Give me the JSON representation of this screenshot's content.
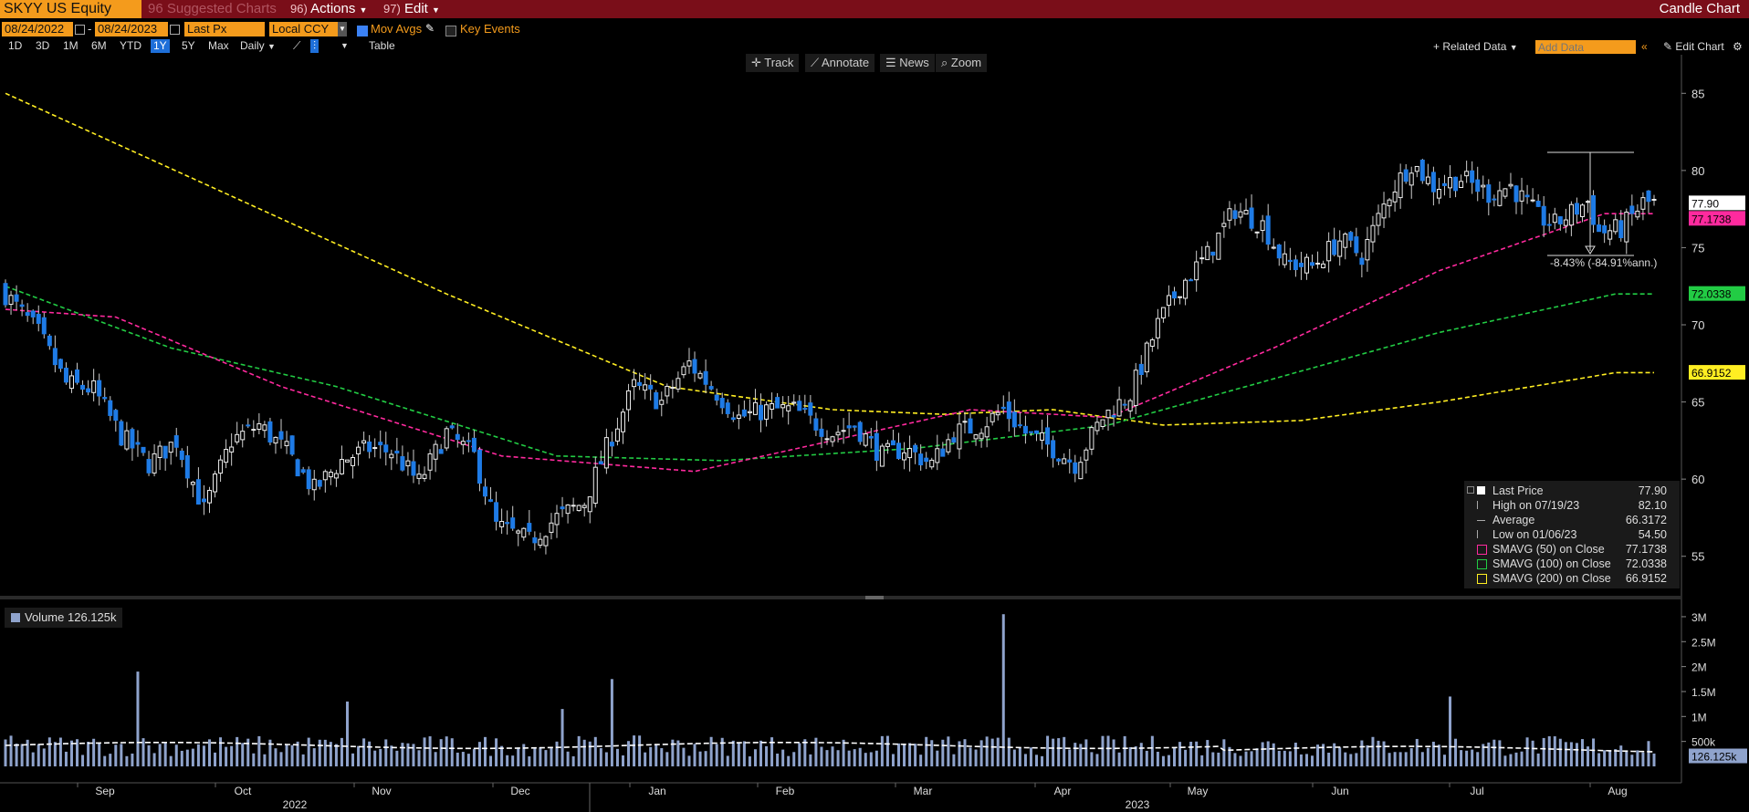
{
  "header": {
    "ticker": "SKYY US Equity",
    "suggested_charts": "Suggested Charts",
    "suggested_num": "96",
    "actions_num": "96)",
    "actions": "Actions",
    "edit_num": "97)",
    "edit": "Edit",
    "chart_type": "Candle Chart"
  },
  "controls": {
    "start_date": "08/24/2022",
    "end_date": "08/24/2023",
    "field": "Last Px",
    "currency": "Local CCY",
    "mov_avgs": "Mov Avgs",
    "key_events": "Key Events",
    "periods": [
      "1D",
      "3D",
      "1M",
      "6M",
      "YTD",
      "1Y",
      "5Y",
      "Max"
    ],
    "selected_period": "1Y",
    "frequency": "Daily",
    "table": "Table",
    "related_data": "+ Related Data",
    "add_data_placeholder": "Add Data",
    "edit_chart": "Edit Chart"
  },
  "tools": [
    "Track",
    "Annotate",
    "News",
    "Zoom"
  ],
  "legend": {
    "items": [
      {
        "name": "Last Price",
        "value": "77.90",
        "color": "#ffffff"
      },
      {
        "name": "High on 07/19/23",
        "value": "82.10",
        "color": "#bbbbbb"
      },
      {
        "name": "Average",
        "value": "66.3172",
        "color": "#bbbbbb"
      },
      {
        "name": "Low on 01/06/23",
        "value": "54.50",
        "color": "#bbbbbb"
      },
      {
        "name": "SMAVG (50)  on Close",
        "value": "77.1738",
        "color": "#ff2a9e"
      },
      {
        "name": "SMAVG (100)  on Close",
        "value": "72.0338",
        "color": "#22cc44"
      },
      {
        "name": "SMAVG (200)  on Close",
        "value": "66.9152",
        "color": "#ffee22"
      }
    ]
  },
  "chart_data": {
    "type": "candlestick",
    "price_axis": {
      "ticks": [
        55,
        60,
        65,
        70,
        75,
        80,
        85
      ],
      "range": [
        52.5,
        87.5
      ]
    },
    "x_axis": {
      "months": [
        "Sep",
        "Oct",
        "Nov",
        "Dec",
        "Jan",
        "Feb",
        "Mar",
        "Apr",
        "May",
        "Jun",
        "Jul",
        "Aug"
      ],
      "years": [
        "2022",
        "2023"
      ]
    },
    "price_series": [
      [
        0,
        72.0
      ],
      [
        6,
        69.5
      ],
      [
        11,
        66.2
      ],
      [
        16,
        65.8
      ],
      [
        21,
        62.8
      ],
      [
        26,
        61.0
      ],
      [
        31,
        62.5
      ],
      [
        36,
        58.0
      ],
      [
        41,
        62.5
      ],
      [
        46,
        63.5
      ],
      [
        51,
        61.8
      ],
      [
        56,
        59.3
      ],
      [
        61,
        61.2
      ],
      [
        66,
        62.0
      ],
      [
        70,
        61.8
      ],
      [
        75,
        59.8
      ],
      [
        80,
        63.0
      ],
      [
        85,
        61.5
      ],
      [
        89,
        57.0
      ],
      [
        95,
        56.0
      ],
      [
        100,
        57.5
      ],
      [
        105,
        58.5
      ],
      [
        109,
        62.0
      ],
      [
        114,
        66.0
      ],
      [
        119,
        65.0
      ],
      [
        124,
        67.5
      ],
      [
        128,
        66.0
      ],
      [
        133,
        64.0
      ],
      [
        138,
        64.5
      ],
      [
        143,
        64.5
      ],
      [
        146,
        63.8
      ],
      [
        150,
        63.0
      ],
      [
        154,
        63.5
      ],
      [
        159,
        61.5
      ],
      [
        163,
        62.0
      ],
      [
        168,
        61.0
      ],
      [
        172,
        63.0
      ],
      [
        177,
        63.5
      ],
      [
        181,
        64.5
      ],
      [
        185,
        63.0
      ],
      [
        190,
        62.0
      ],
      [
        194,
        61.0
      ],
      [
        199,
        64.0
      ],
      [
        204,
        65.5
      ],
      [
        209,
        70.0
      ],
      [
        213,
        72.5
      ],
      [
        218,
        74.5
      ],
      [
        223,
        77.5
      ],
      [
        228,
        76.5
      ],
      [
        232,
        74.0
      ],
      [
        237,
        73.8
      ],
      [
        242,
        75.5
      ],
      [
        246,
        74.5
      ],
      [
        251,
        78.5
      ],
      [
        255,
        80.5
      ],
      [
        259,
        79.0
      ],
      [
        264,
        79.5
      ],
      [
        269,
        78.5
      ],
      [
        273,
        79.0
      ],
      [
        278,
        77.0
      ],
      [
        281,
        76.5
      ],
      [
        287,
        78.0
      ],
      [
        289,
        76.0
      ],
      [
        293,
        76.2
      ],
      [
        297,
        77.9
      ]
    ],
    "sma50": [
      [
        0,
        71.0
      ],
      [
        20,
        70.5
      ],
      [
        50,
        66.0
      ],
      [
        90,
        61.5
      ],
      [
        125,
        60.5
      ],
      [
        150,
        62.5
      ],
      [
        175,
        64.5
      ],
      [
        200,
        64.0
      ],
      [
        230,
        68.5
      ],
      [
        260,
        73.5
      ],
      [
        290,
        77.2
      ]
    ],
    "sma100": [
      [
        0,
        72.5
      ],
      [
        30,
        68.5
      ],
      [
        60,
        66.0
      ],
      [
        100,
        61.5
      ],
      [
        130,
        61.2
      ],
      [
        165,
        62.0
      ],
      [
        200,
        63.5
      ],
      [
        230,
        66.5
      ],
      [
        260,
        69.5
      ],
      [
        292,
        72.0
      ]
    ],
    "sma200": [
      [
        0,
        85.0
      ],
      [
        40,
        78.5
      ],
      [
        80,
        72.0
      ],
      [
        120,
        66.0
      ],
      [
        150,
        64.5
      ],
      [
        170,
        64.2
      ],
      [
        190,
        64.5
      ],
      [
        210,
        63.5
      ],
      [
        235,
        63.8
      ],
      [
        260,
        65.0
      ],
      [
        292,
        66.9
      ]
    ],
    "volume_axis": {
      "ticks": [
        "500k",
        "1M",
        "1.5M",
        "2M",
        "2.5M",
        "3M"
      ],
      "range": [
        0,
        3200000
      ]
    },
    "volume_label": "Volume",
    "volume_last": "126.125k",
    "volume_spikes": [
      [
        24,
        1900000
      ],
      [
        62,
        1300000
      ],
      [
        101,
        1150000
      ],
      [
        110,
        1750000
      ],
      [
        181,
        3050000
      ],
      [
        262,
        1400000
      ]
    ],
    "annotation": "-8.43% (-84.91%ann.)",
    "price_labels": [
      {
        "value": "77.90",
        "price": 77.9,
        "bg": "#ffffff",
        "fg": "#000000"
      },
      {
        "value": "77.1738",
        "price": 76.9,
        "bg": "#ff2a9e",
        "fg": "#000000"
      },
      {
        "value": "72.0338",
        "price": 72.03,
        "bg": "#22cc44",
        "fg": "#000000"
      },
      {
        "value": "66.9152",
        "price": 66.92,
        "bg": "#ffee22",
        "fg": "#000000"
      }
    ],
    "volume_price_label": "126.125k"
  }
}
